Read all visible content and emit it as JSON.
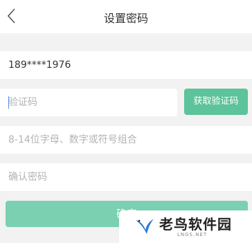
{
  "header": {
    "title": "设置密码",
    "back_icon": "chevron-left-icon"
  },
  "form": {
    "phone_value": "189****1976",
    "code_placeholder": "验证码",
    "get_code_label": "获取验证码",
    "password_placeholder": "8-14位字母、数字或符号组合",
    "confirm_placeholder": "确认密码",
    "submit_label": "确定"
  },
  "watermark": {
    "title": "老鸟软件园",
    "subtitle": "LNGS.NET"
  },
  "colors": {
    "accent": "#5cc39a",
    "button_disabled": "#7ad0b0",
    "background": "#f2f2f2"
  }
}
